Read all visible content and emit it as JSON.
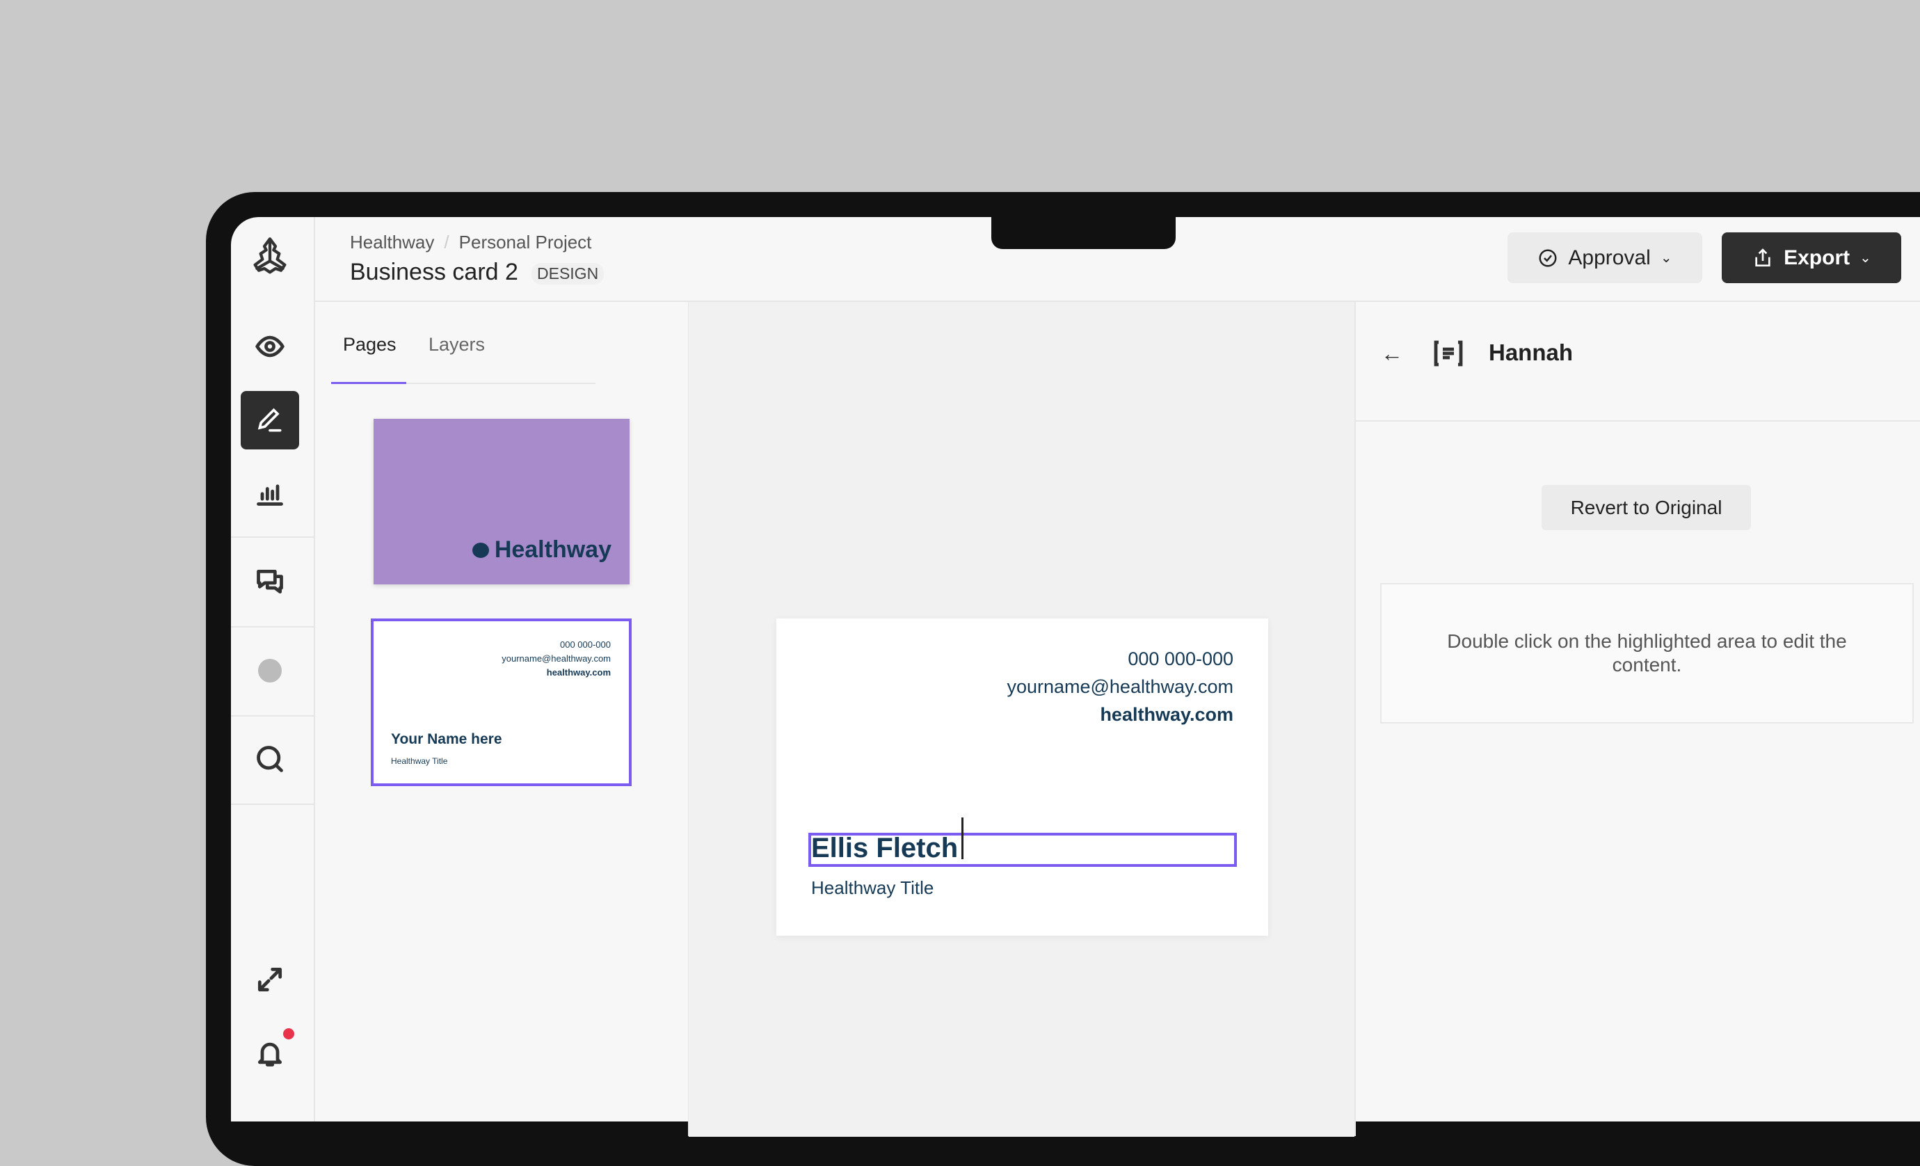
{
  "header": {
    "breadcrumb": [
      "Healthway",
      "Personal Project"
    ],
    "separator": "/",
    "title": "Business card 2",
    "badge": "DESIGN",
    "approval_label": "Approval",
    "export_label": "Export"
  },
  "rail": {
    "icons": [
      "logo-icon",
      "eye-icon",
      "pencil-icon",
      "bar-chart-icon",
      "chat-icon",
      "status-dot-icon",
      "search-icon",
      "expand-icon",
      "bell-icon"
    ],
    "active": "pencil-icon",
    "notification_color": "#e8334a"
  },
  "panel": {
    "tabs": [
      {
        "label": "Pages",
        "active": true
      },
      {
        "label": "Layers",
        "active": false
      }
    ],
    "thumb1": {
      "brand": "Healthway",
      "color": "#a78bcb"
    },
    "thumb2": {
      "phone": "000 000-000",
      "email": "yourname@healthway.com",
      "site": "healthway.com",
      "name": "Your Name here",
      "title": "Healthway Title"
    }
  },
  "canvas": {
    "card": {
      "phone": "000 000-000",
      "email": "yourname@healthway.com",
      "site": "healthway.com",
      "name_value": "Ellis Fletch",
      "title": "Healthway Title"
    },
    "accent": "#7c5cf0"
  },
  "right": {
    "name": "Hannah",
    "revert_label": "Revert to Original",
    "hint": "Double click on the highlighted area to edit the content."
  }
}
